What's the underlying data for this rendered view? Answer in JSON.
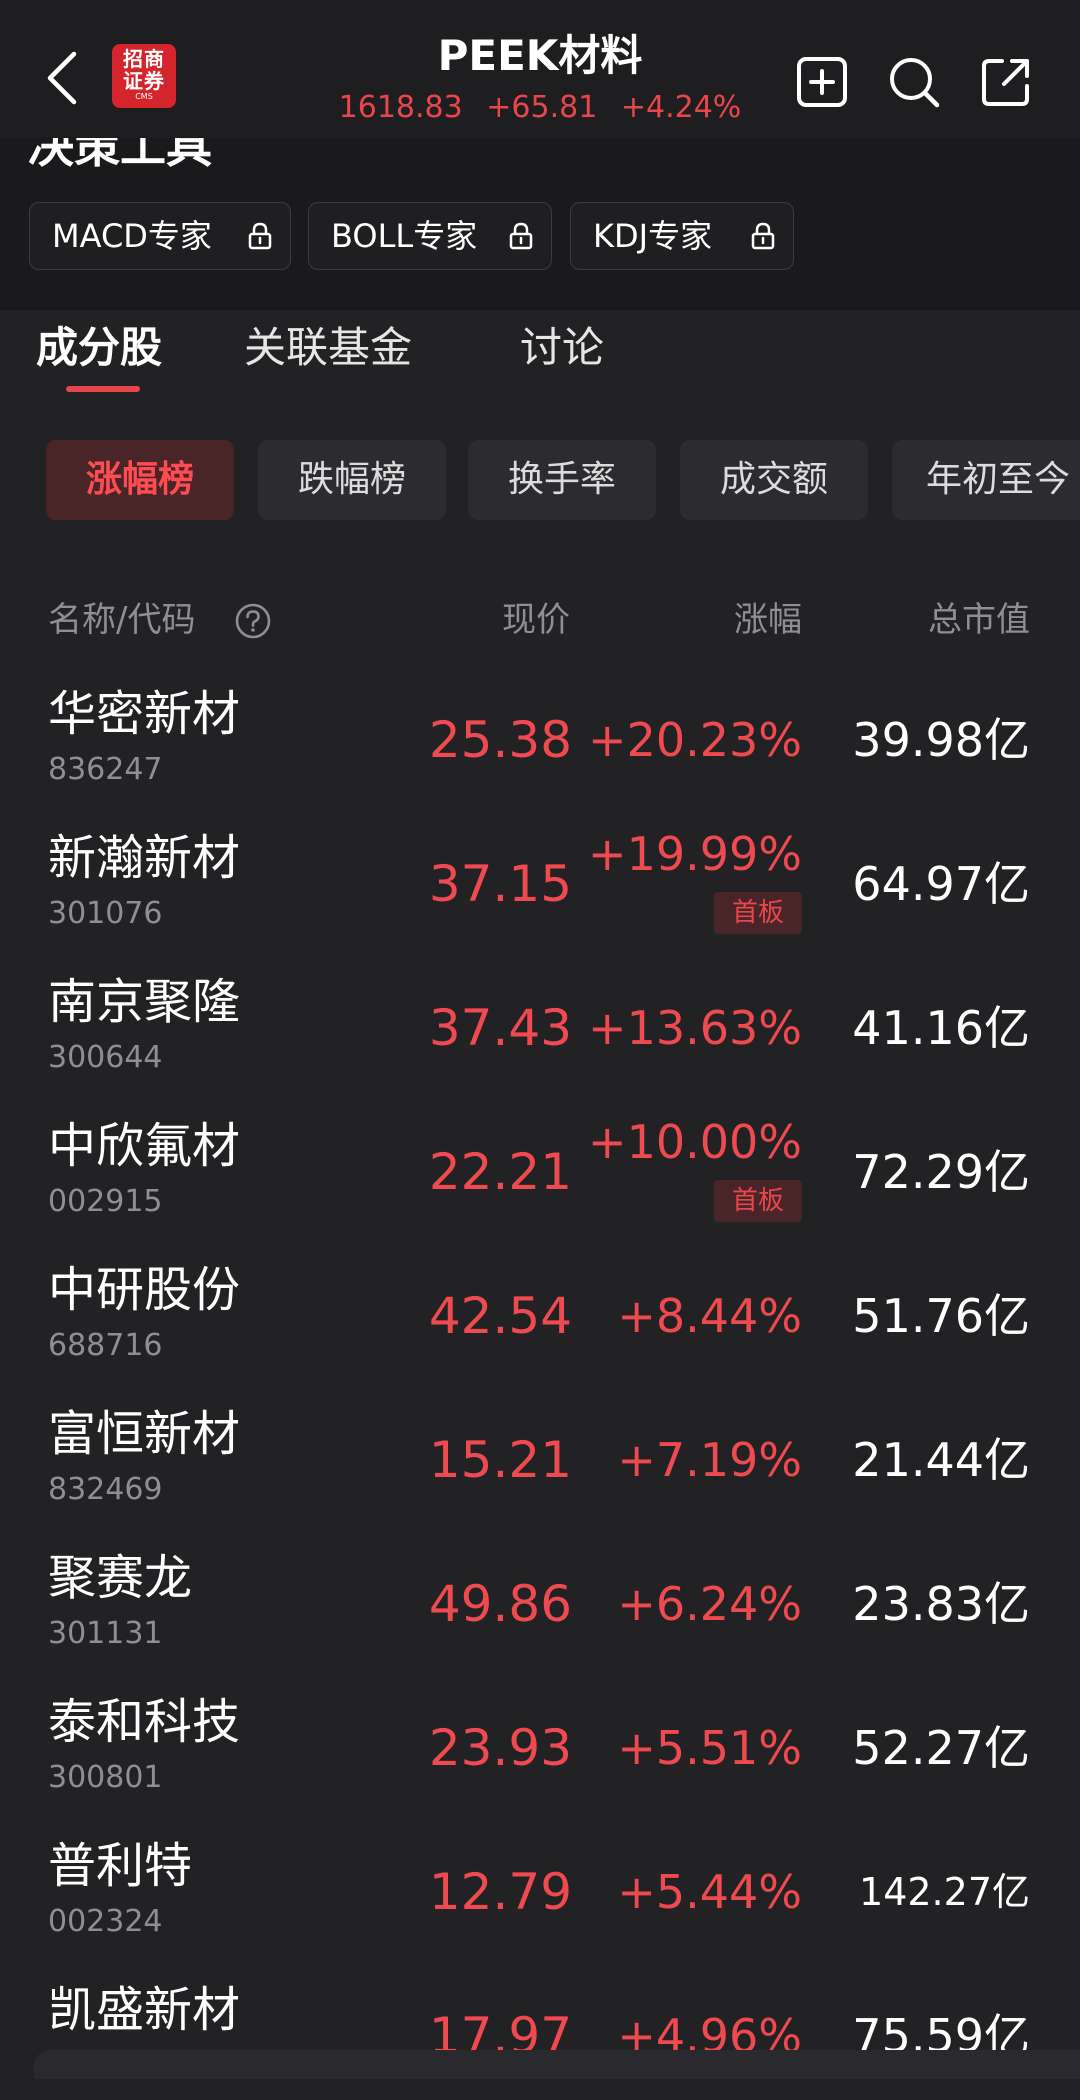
{
  "header": {
    "title": "PEEK材料",
    "price": "1618.83",
    "change": "+65.81",
    "change_pct": "+4.24%",
    "logo_line1": "招商",
    "logo_line2": "证券",
    "logo_line3": "CMS",
    "icons": [
      "back-icon",
      "add-watchlist-icon",
      "search-icon",
      "share-icon"
    ]
  },
  "tools": {
    "title": "决策工具",
    "chips": [
      "MACD专家",
      "BOLL专家",
      "KDJ专家"
    ]
  },
  "tabs": [
    "成分股",
    "关联基金",
    "讨论"
  ],
  "rank_pills": [
    "涨幅榜",
    "跌幅榜",
    "换手率",
    "成交额",
    "年初至今"
  ],
  "table": {
    "headers": {
      "name": "名称/代码",
      "price": "现价",
      "change": "涨幅",
      "market_cap": "总市值"
    },
    "rows": [
      {
        "name": "华密新材",
        "code": "836247",
        "price": "25.38",
        "change": "+20.23%",
        "badge": "",
        "market_cap": "39.98亿"
      },
      {
        "name": "新瀚新材",
        "code": "301076",
        "price": "37.15",
        "change": "+19.99%",
        "badge": "首板",
        "market_cap": "64.97亿"
      },
      {
        "name": "南京聚隆",
        "code": "300644",
        "price": "37.43",
        "change": "+13.63%",
        "badge": "",
        "market_cap": "41.16亿"
      },
      {
        "name": "中欣氟材",
        "code": "002915",
        "price": "22.21",
        "change": "+10.00%",
        "badge": "首板",
        "market_cap": "72.29亿"
      },
      {
        "name": "中研股份",
        "code": "688716",
        "price": "42.54",
        "change": "+8.44%",
        "badge": "",
        "market_cap": "51.76亿"
      },
      {
        "name": "富恒新材",
        "code": "832469",
        "price": "15.21",
        "change": "+7.19%",
        "badge": "",
        "market_cap": "21.44亿"
      },
      {
        "name": "聚赛龙",
        "code": "301131",
        "price": "49.86",
        "change": "+6.24%",
        "badge": "",
        "market_cap": "23.83亿"
      },
      {
        "name": "泰和科技",
        "code": "300801",
        "price": "23.93",
        "change": "+5.51%",
        "badge": "",
        "market_cap": "52.27亿"
      },
      {
        "name": "普利特",
        "code": "002324",
        "price": "12.79",
        "change": "+5.44%",
        "badge": "",
        "market_cap": "142.27亿"
      },
      {
        "name": "凯盛新材",
        "code": "",
        "price": "17.97",
        "change": "+4.96%",
        "badge": "",
        "market_cap": "75.59亿"
      }
    ]
  },
  "colors": {
    "up": "#ef4a50",
    "background": "#222225",
    "muted": "#8e8e93"
  }
}
